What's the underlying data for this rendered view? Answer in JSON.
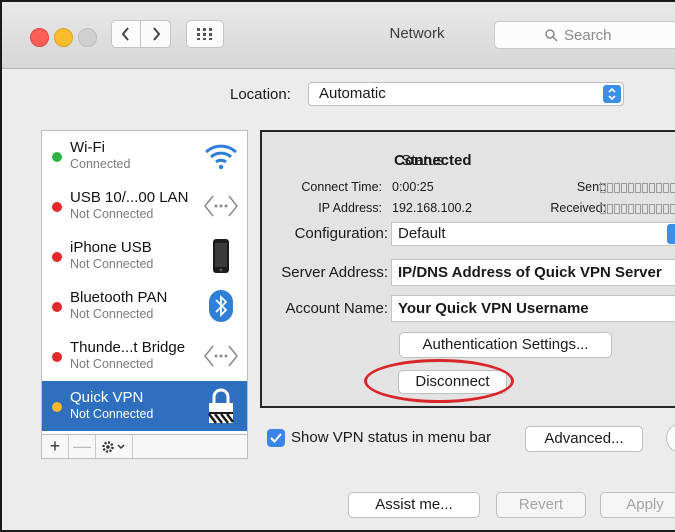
{
  "window": {
    "title": "Network",
    "search_placeholder": "Search"
  },
  "location": {
    "label": "Location:",
    "value": "Automatic"
  },
  "services": [
    {
      "name": "Wi-Fi",
      "status": "Connected",
      "dot_color": "#2bb540",
      "icon": "wifi-icon"
    },
    {
      "name": "USB 10/...00 LAN",
      "status": "Not Connected",
      "dot_color": "#e5262a",
      "icon": "ethernet-arrows-icon"
    },
    {
      "name": "iPhone USB",
      "status": "Not Connected",
      "dot_color": "#e5262a",
      "icon": "iphone-icon"
    },
    {
      "name": "Bluetooth PAN",
      "status": "Not Connected",
      "dot_color": "#e5262a",
      "icon": "bluetooth-icon"
    },
    {
      "name": "Thunde...t Bridge",
      "status": "Not Connected",
      "dot_color": "#e5262a",
      "icon": "ethernet-arrows-icon"
    },
    {
      "name": "Quick VPN",
      "status": "Not Connected",
      "dot_color": "#f6b823",
      "icon": "vpn-lock-icon",
      "selected": true
    }
  ],
  "list_toolbar": {
    "add": "+",
    "remove": "—",
    "gear": "gear-icon"
  },
  "detail": {
    "status_label": "Status:",
    "status_value": "Connected",
    "connect_time_label": "Connect Time:",
    "connect_time_value": "0:00:25",
    "ip_label": "IP Address:",
    "ip_value": "192.168.100.2",
    "sent_label": "Sent:",
    "received_label": "Received:",
    "configuration_label": "Configuration:",
    "configuration_value": "Default",
    "server_label": "Server Address:",
    "server_value": "IP/DNS Address of Quick VPN Server",
    "account_label": "Account Name:",
    "account_value": "Your Quick VPN Username",
    "auth_button": "Authentication Settings...",
    "disconnect_button": "Disconnect"
  },
  "show_vpn": {
    "label": "Show VPN status in menu bar",
    "checked": true
  },
  "advanced_button": "Advanced...",
  "help_button": "?",
  "footer": {
    "assist": "Assist me...",
    "revert": "Revert",
    "apply": "Apply"
  },
  "colors": {
    "selection": "#2f6fc0",
    "accent": "#3d8ee9",
    "highlight_ring": "#d9262b"
  }
}
